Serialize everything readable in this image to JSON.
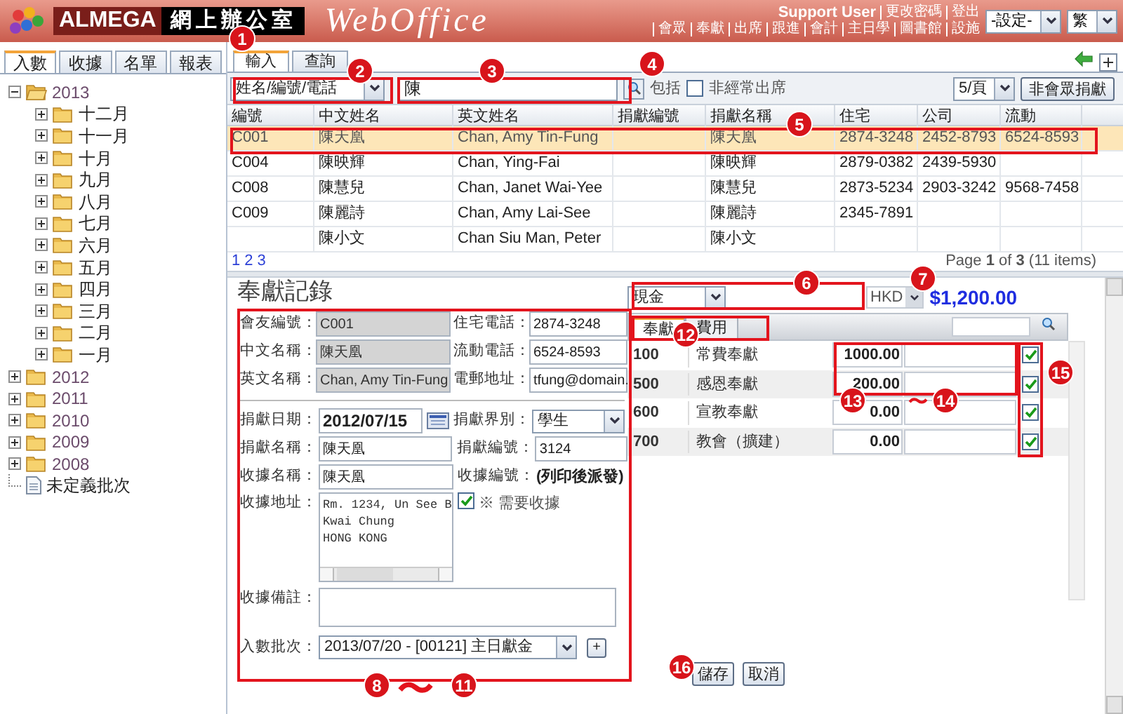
{
  "header": {
    "brand": "ALMEGA",
    "title": "網上辦公室",
    "product": "WebOffice",
    "user": "Support User",
    "user_links": [
      "更改密碼",
      "登出"
    ],
    "nav": [
      "會眾",
      "奉獻",
      "出席",
      "跟進",
      "會計",
      "主日學",
      "圖書館",
      "設施"
    ],
    "settings_select": "-設定-",
    "language_select": "繁"
  },
  "sidebar": {
    "tabs": [
      {
        "label": "入數",
        "selected": true
      },
      {
        "label": "收據",
        "selected": false
      },
      {
        "label": "名單",
        "selected": false
      },
      {
        "label": "報表",
        "selected": false
      }
    ],
    "tree": [
      {
        "kind": "folder",
        "label": "2013",
        "expanded": true,
        "children": [
          {
            "kind": "folder",
            "label": "十二月",
            "expanded": false
          },
          {
            "kind": "folder",
            "label": "十一月",
            "expanded": false
          },
          {
            "kind": "folder",
            "label": "十月",
            "expanded": false
          },
          {
            "kind": "folder",
            "label": "九月",
            "expanded": false
          },
          {
            "kind": "folder",
            "label": "八月",
            "expanded": false
          },
          {
            "kind": "folder",
            "label": "七月",
            "expanded": false
          },
          {
            "kind": "folder",
            "label": "六月",
            "expanded": false
          },
          {
            "kind": "folder",
            "label": "五月",
            "expanded": false
          },
          {
            "kind": "folder",
            "label": "四月",
            "expanded": false
          },
          {
            "kind": "folder",
            "label": "三月",
            "expanded": false
          },
          {
            "kind": "folder",
            "label": "二月",
            "expanded": false
          },
          {
            "kind": "folder",
            "label": "一月",
            "expanded": false
          }
        ]
      },
      {
        "kind": "folder",
        "label": "2012",
        "expanded": false
      },
      {
        "kind": "folder",
        "label": "2011",
        "expanded": false
      },
      {
        "kind": "folder",
        "label": "2010",
        "expanded": false
      },
      {
        "kind": "folder",
        "label": "2009",
        "expanded": false
      },
      {
        "kind": "folder",
        "label": "2008",
        "expanded": false
      },
      {
        "kind": "file",
        "label": "未定義批次"
      }
    ]
  },
  "main_tabs": [
    {
      "label": "輸入",
      "selected": true
    },
    {
      "label": "查詢",
      "selected": false
    }
  ],
  "search": {
    "field_select": "姓名/編號/電話",
    "value": "陳",
    "include_label": "包括",
    "irregular": {
      "label": "非經常出席",
      "checked": false
    },
    "page_size": "5/頁",
    "non_member_button": "非會眾捐獻"
  },
  "table": {
    "columns": [
      "編號",
      "中文姓名",
      "英文姓名",
      "捐獻編號",
      "捐獻名稱",
      "住宅",
      "公司",
      "流動"
    ],
    "rows": [
      {
        "selected": true,
        "cells": [
          "C001",
          "陳天凰",
          "Chan, Amy Tin-Fung",
          "",
          "陳天凰",
          "2874-3248",
          "2452-8793",
          "6524-8593"
        ]
      },
      {
        "selected": false,
        "cells": [
          "C004",
          "陳映輝",
          "Chan, Ying-Fai",
          "",
          "陳映輝",
          "2879-0382",
          "2439-5930",
          ""
        ]
      },
      {
        "selected": false,
        "cells": [
          "C008",
          "陳慧兒",
          "Chan, Janet Wai-Yee",
          "",
          "陳慧兒",
          "2873-5234",
          "2903-3242",
          "9568-7458"
        ]
      },
      {
        "selected": false,
        "cells": [
          "C009",
          "陳麗詩",
          "Chan, Amy Lai-See",
          "",
          "陳麗詩",
          "2345-7891",
          "",
          ""
        ]
      },
      {
        "selected": false,
        "cells": [
          "",
          "陳小文",
          "Chan Siu Man, Peter",
          "",
          "陳小文",
          "",
          "",
          ""
        ]
      }
    ],
    "pages": [
      "1",
      "2",
      "3"
    ],
    "summary": "Page **1** of **3** (11 items)"
  },
  "record": {
    "title": "奉獻記錄",
    "member_fields": [
      {
        "label": "會友編號：",
        "value": "C001"
      },
      {
        "label": "住宅電話：",
        "value": "2874-3248"
      },
      {
        "label": "中文名稱：",
        "value": "陳天凰"
      },
      {
        "label": "流動電話：",
        "value": "6524-8593"
      },
      {
        "label": "英文名稱：",
        "value": "Chan, Amy Tin-Fung"
      },
      {
        "label": "電郵地址：",
        "value": "tfung@domain."
      }
    ],
    "date_label": "捐獻日期：",
    "date": "2012/07/15",
    "sector_label": "捐獻界別：",
    "sector": "學生",
    "donor_name_label": "捐獻名稱：",
    "donor_name": "陳天凰",
    "donor_no_label": "捐獻編號：",
    "donor_no": "3124",
    "receipt_name_label": "收據名稱：",
    "receipt_name": "陳天凰",
    "receipt_no_label": "收據編號：",
    "receipt_no": "(列印後派發)",
    "address_label": "收據地址：",
    "address": [
      "Rm. 1234, Un See B",
      "Kwai Chung",
      "HONG KONG"
    ],
    "need_receipt": {
      "label": "※ 需要收據",
      "checked": true
    },
    "remark_label": "收據備註：",
    "batch_label": "入數批次：",
    "batch": "2013/07/20 - [00121] 主日獻金",
    "add_button": "+"
  },
  "payment": {
    "method": "現金",
    "currency": "HKD",
    "total": "$1,200.00",
    "tabs": [
      {
        "label": "奉獻",
        "selected": true
      },
      {
        "label": "費用",
        "selected": false
      }
    ],
    "items": [
      {
        "code": "100",
        "name": "常費奉獻",
        "amount": "1000.00",
        "checked": true
      },
      {
        "code": "500",
        "name": "感恩奉獻",
        "amount": "200.00",
        "checked": true
      },
      {
        "code": "600",
        "name": "宣教奉獻",
        "amount": "0.00",
        "checked": true
      },
      {
        "code": "700",
        "name": "教會（擴建）",
        "amount": "0.00",
        "checked": true
      }
    ],
    "buttons": [
      "儲存",
      "取消"
    ]
  },
  "callouts": [
    {
      "label": "1"
    },
    {
      "label": "2"
    },
    {
      "label": "3"
    },
    {
      "label": "4"
    },
    {
      "label": "5"
    },
    {
      "label": "6"
    },
    {
      "label": "7"
    },
    {
      "label": "8"
    },
    {
      "label": "11"
    },
    {
      "label": "12"
    },
    {
      "label": "13"
    },
    {
      "label": "14"
    },
    {
      "label": "15"
    },
    {
      "label": "16"
    }
  ],
  "callout_ranges": [
    "〜",
    "〜"
  ]
}
